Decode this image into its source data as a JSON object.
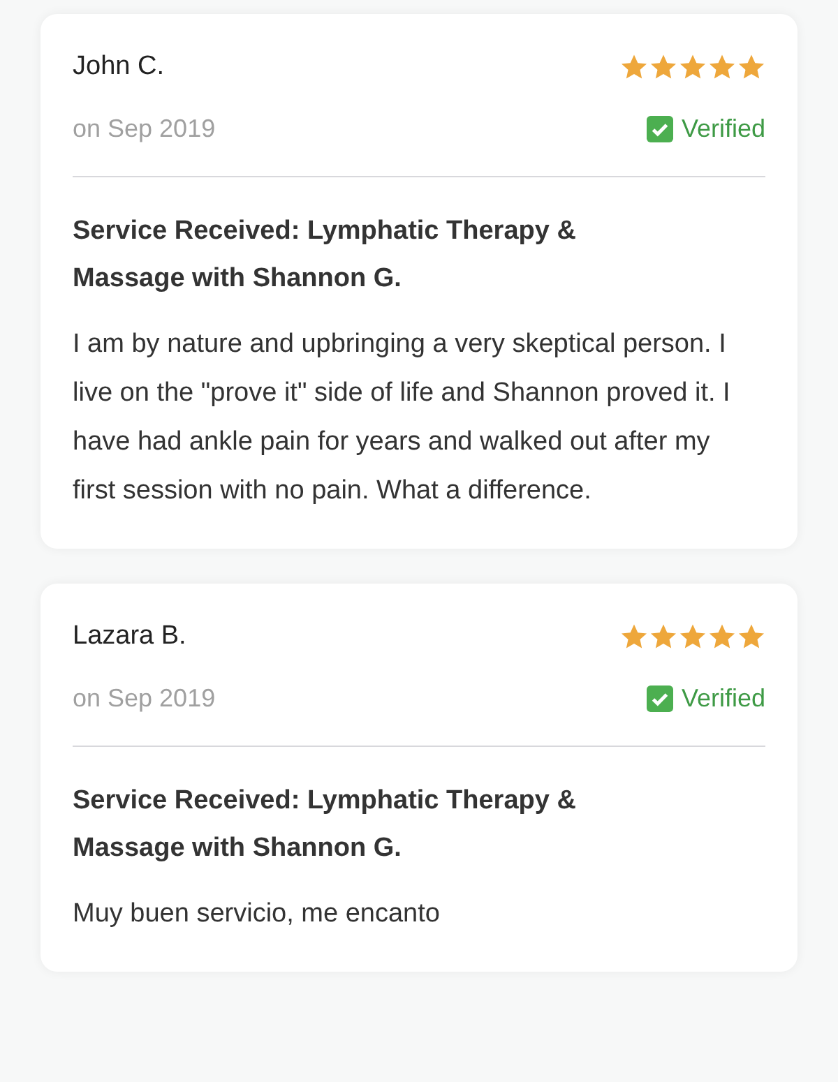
{
  "reviews": [
    {
      "name": "John C.",
      "stars": 5,
      "date": "on Sep 2019",
      "verified": true,
      "verified_label": "Verified",
      "service": "Service Received: Lymphatic Therapy & Massage with Shannon G.",
      "text": "I am by nature and upbringing a very skeptical person. I live on the \"prove it\" side of life and Shannon proved it. I have had ankle pain for years and walked out after my first session with no pain. What a difference."
    },
    {
      "name": "Lazara B.",
      "stars": 5,
      "date": "on Sep 2019",
      "verified": true,
      "verified_label": "Verified",
      "service": "Service Received: Lymphatic Therapy & Massage with Shannon G.",
      "text": "Muy buen servicio, me encanto"
    }
  ]
}
